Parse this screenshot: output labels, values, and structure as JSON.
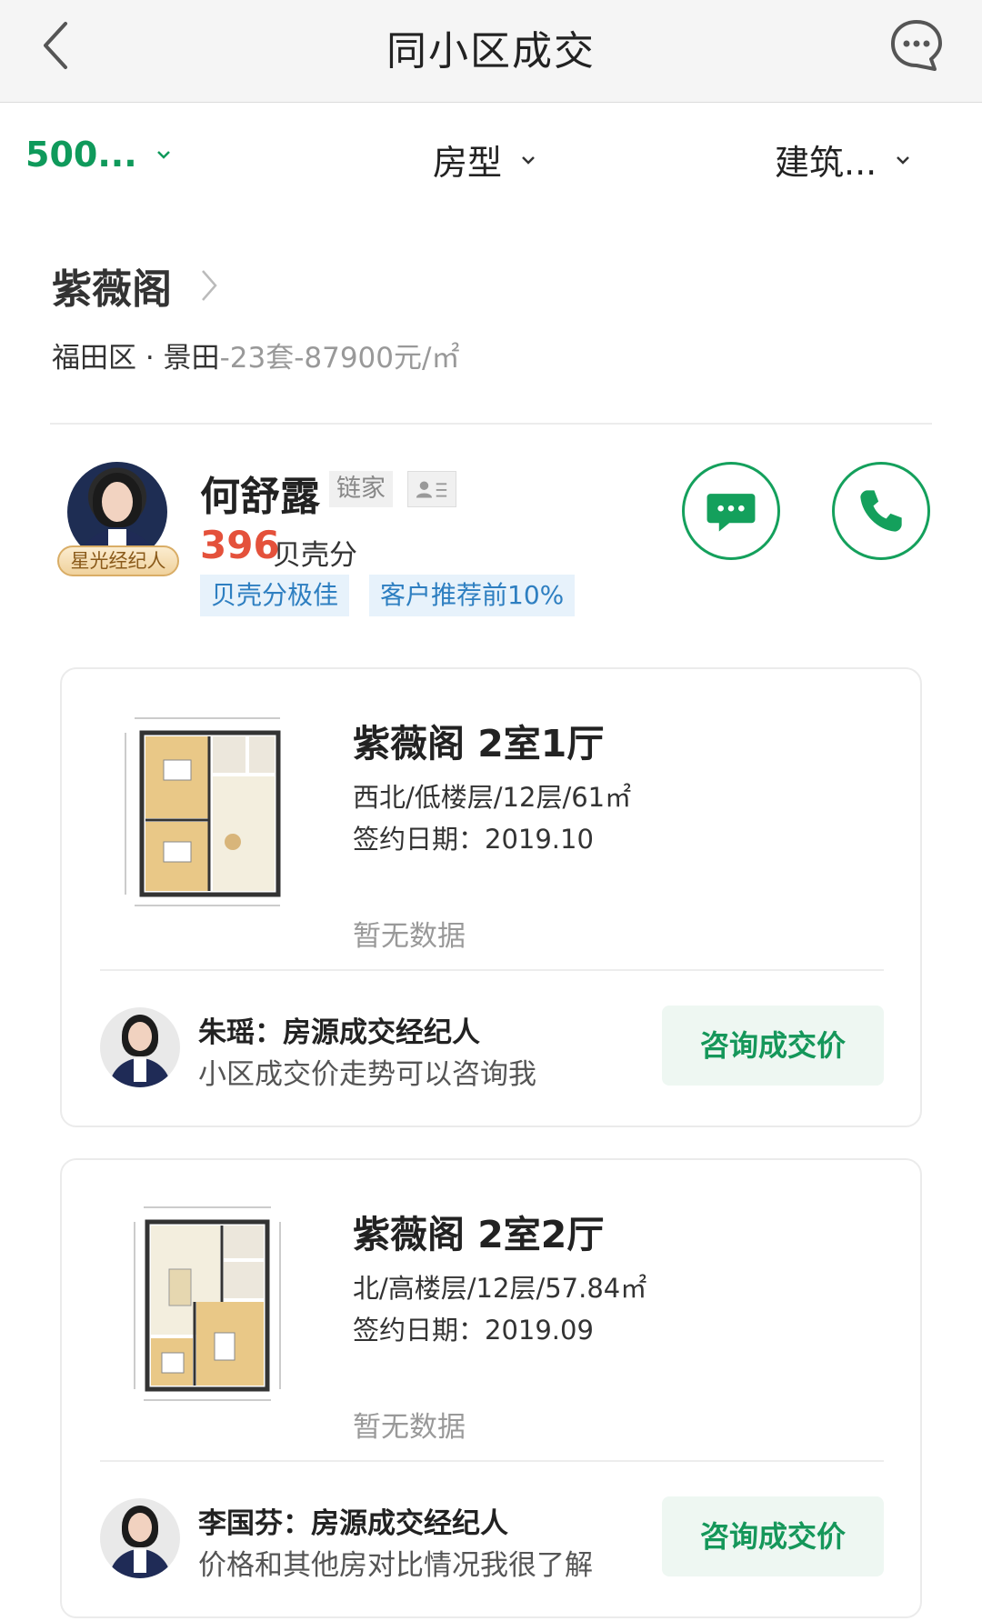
{
  "header": {
    "title": "同小区成交"
  },
  "filters": [
    {
      "label": "500...",
      "active": true
    },
    {
      "label": "房型",
      "active": false
    },
    {
      "label": "建筑...",
      "active": false
    }
  ],
  "community": {
    "name": "紫薇阁",
    "district": "福田区 · 景田",
    "stats": "-23套-87900元/㎡"
  },
  "agent": {
    "name": "何舒露",
    "company": "链家",
    "badge": "星光经纪人",
    "score": "396",
    "score_label": "贝壳分",
    "tags": [
      "贝壳分极佳",
      "客户推荐前10%"
    ]
  },
  "deals": [
    {
      "title": "紫薇阁 2室1厅",
      "meta": "西北/低楼层/12层/61㎡",
      "date": "签约日期：2019.10",
      "price": "暂无数据",
      "agent_name": "朱瑶：房源成交经纪人",
      "agent_desc": "小区成交价走势可以咨询我",
      "button": "咨询成交价"
    },
    {
      "title": "紫薇阁 2室2厅",
      "meta": "北/高楼层/12层/57.84㎡",
      "date": "签约日期：2019.09",
      "price": "暂无数据",
      "agent_name": "李国芬：房源成交经纪人",
      "agent_desc": "价格和其他房对比情况我很了解",
      "button": "咨询成交价"
    }
  ],
  "colors": {
    "accent_green": "#0f9a5b",
    "score_red": "#e4513b",
    "tag_blue": "#2e7fc1"
  }
}
